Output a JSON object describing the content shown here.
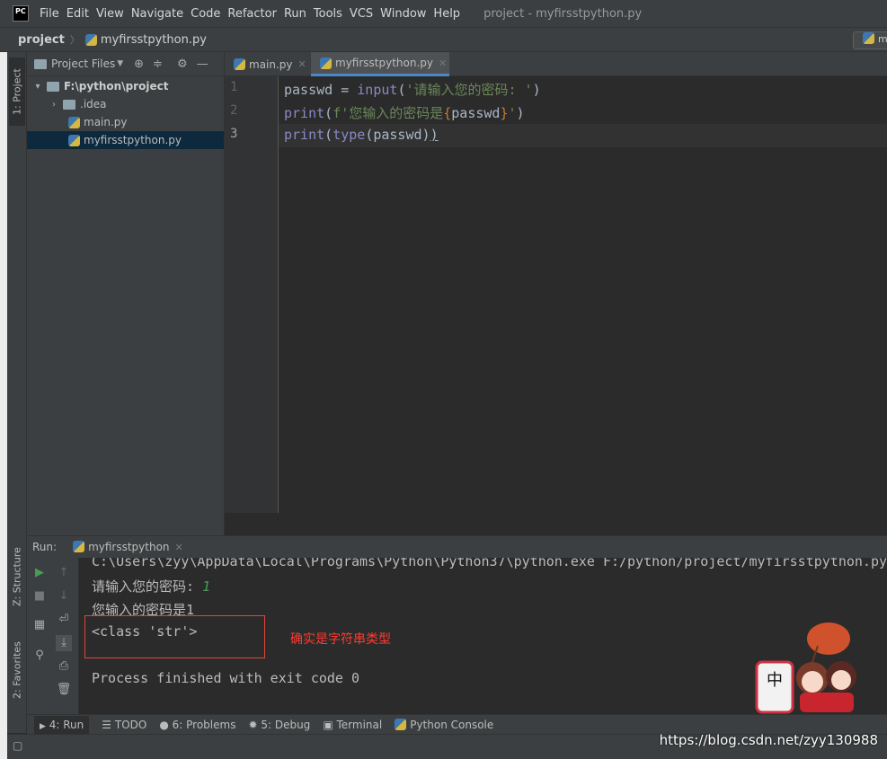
{
  "menubar": {
    "logo": "PC",
    "items": [
      "File",
      "Edit",
      "View",
      "Navigate",
      "Code",
      "Refactor",
      "Run",
      "Tools",
      "VCS",
      "Window",
      "Help"
    ],
    "window_title": "project - myfirsstpython.py"
  },
  "breadcrumb": {
    "project": "project",
    "file": "myfirsstpython.py",
    "run_config": "m"
  },
  "left_stripe": {
    "project_tab": "1: Project",
    "structure_tab": "Z: Structure",
    "favorites_tab": "2: Favorites"
  },
  "project_panel": {
    "title": "Project Files",
    "tree": [
      {
        "label": "F:\\python\\project",
        "type": "root"
      },
      {
        "label": ".idea",
        "type": "folder"
      },
      {
        "label": "main.py",
        "type": "file"
      },
      {
        "label": "myfirsstpython.py",
        "type": "file",
        "selected": true
      }
    ]
  },
  "editor": {
    "tabs": [
      {
        "label": "main.py"
      },
      {
        "label": "myfirsstpython.py",
        "active": true
      }
    ],
    "line_numbers": [
      "1",
      "2",
      "3"
    ]
  },
  "run": {
    "label": "Run:",
    "config": "myfirsstpython",
    "console": [
      "C:\\Users\\zyy\\AppData\\Local\\Programs\\Python\\Python37\\python.exe F:/python/project/myfirsstpython.py",
      "请输入您的密码: ",
      "1",
      "您输入的密码是1",
      "<class 'str'>",
      "Process finished with exit code 0"
    ],
    "annotation": "确实是字符串类型",
    "mascot_text": "中"
  },
  "bottom_tabs": [
    "4: Run",
    "TODO",
    "6: Problems",
    "5: Debug",
    "Terminal",
    "Python Console"
  ],
  "watermark": "https://blog.csdn.net/zyy130988",
  "colors": {
    "accent": "#4a88c7",
    "annotation": "#ff3a2f",
    "run_green": "#499c54"
  }
}
